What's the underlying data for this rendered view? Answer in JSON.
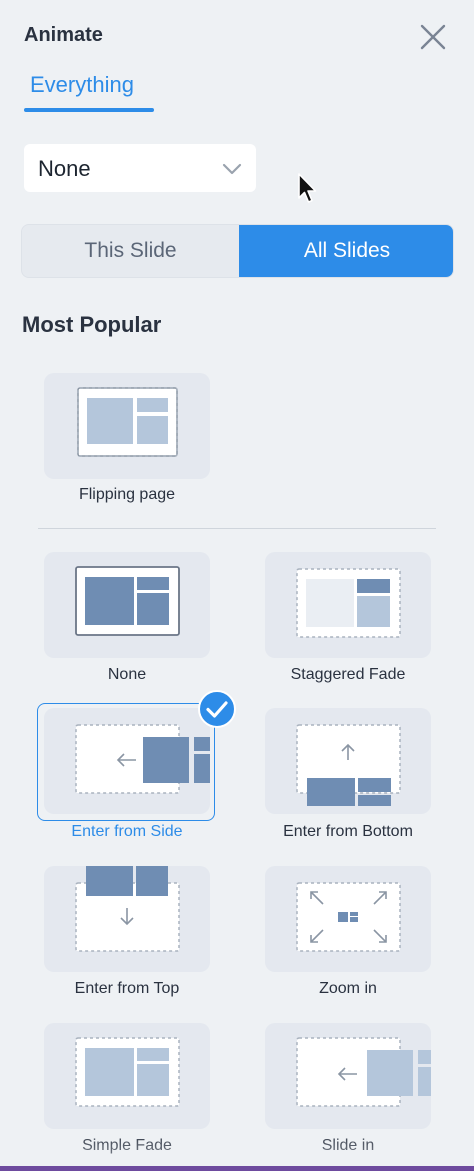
{
  "panel": {
    "title": "Animate",
    "close_icon": "close-icon"
  },
  "tabs": [
    {
      "label": "Everything",
      "active": true
    }
  ],
  "dropdown": {
    "value": "None",
    "icon": "chevron-down-icon"
  },
  "scope_toggle": {
    "options": [
      "This Slide",
      "All Slides"
    ],
    "selected": "All Slides"
  },
  "section": {
    "title": "Most Popular"
  },
  "animations": [
    {
      "label": "Flipping page",
      "selected": false,
      "thumbnail": "flipping-page-thumbnail"
    },
    {
      "label": "None",
      "selected": false,
      "thumbnail": "none-thumbnail"
    },
    {
      "label": "Staggered Fade",
      "selected": false,
      "thumbnail": "staggered-fade-thumbnail"
    },
    {
      "label": "Enter from Side",
      "selected": true,
      "thumbnail": "enter-from-side-thumbnail"
    },
    {
      "label": "Enter from Bottom",
      "selected": false,
      "thumbnail": "enter-from-bottom-thumbnail"
    },
    {
      "label": "Enter from Top",
      "selected": false,
      "thumbnail": "enter-from-top-thumbnail"
    },
    {
      "label": "Zoom in",
      "selected": false,
      "thumbnail": "zoom-in-thumbnail"
    },
    {
      "label": "Simple Fade",
      "selected": false,
      "thumbnail": "simple-fade-thumbnail"
    },
    {
      "label": "Slide in",
      "selected": false,
      "thumbnail": "slide-in-thumbnail"
    }
  ],
  "colors": {
    "accent": "#2d8ce8",
    "panel_bg": "#eef1f4",
    "card_bg": "#e4e8ef",
    "block_dark": "#6f8db3",
    "block_light": "#b4c6db"
  }
}
